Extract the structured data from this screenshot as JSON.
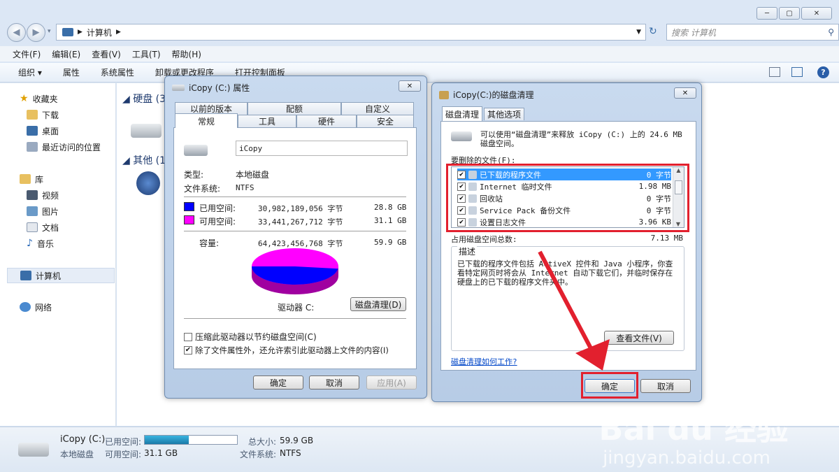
{
  "explorer": {
    "address": "计算机",
    "search_placeholder": "搜索 计算机",
    "menu": [
      "文件(F)",
      "编辑(E)",
      "查看(V)",
      "工具(T)",
      "帮助(H)"
    ],
    "commands": [
      "组织 ▾",
      "属性",
      "系统属性",
      "卸载或更改程序",
      "打开控制面板"
    ],
    "sidebar": {
      "favorites": "收藏夹",
      "fav_items": [
        "下载",
        "桌面",
        "最近访问的位置"
      ],
      "library": "库",
      "lib_items": [
        "视频",
        "图片",
        "文档",
        "音乐"
      ],
      "computer": "计算机",
      "network": "网络"
    },
    "groups": {
      "disk": "硬盘 (3",
      "other": "其他 (1"
    }
  },
  "status": {
    "drive_name": "iCopy (C:)",
    "drive_type": "本地磁盘",
    "used_label": "已用空间:",
    "free_label": "可用空间:",
    "free_value": "31.1 GB",
    "total_label": "总大小:",
    "total_value": "59.9 GB",
    "fs_label": "文件系统:",
    "fs_value": "NTFS",
    "used_fraction": 0.48
  },
  "props": {
    "title": "iCopy (C:) 属性",
    "tabs_back": [
      "以前的版本",
      "配额",
      "自定义"
    ],
    "tabs_front": [
      "常规",
      "工具",
      "硬件",
      "安全"
    ],
    "name_value": "iCopy",
    "type_label": "类型:",
    "type_value": "本地磁盘",
    "fs_label": "文件系统:",
    "fs_value": "NTFS",
    "used_label": "已用空间:",
    "used_bytes": "30,982,189,056 字节",
    "used_gb": "28.8 GB",
    "free_label": "可用空间:",
    "free_bytes": "33,441,267,712 字节",
    "free_gb": "31.1 GB",
    "cap_label": "容量:",
    "cap_bytes": "64,423,456,768 字节",
    "cap_gb": "59.9 GB",
    "drive_label": "驱动器 C:",
    "cleanup_btn": "磁盘清理(D)",
    "compress_label": "压缩此驱动器以节约磁盘空间(C)",
    "index_label": "除了文件属性外，还允许索引此驱动器上文件的内容(I)",
    "ok": "确定",
    "cancel": "取消",
    "apply": "应用(A)",
    "colors": {
      "used": "#0000ff",
      "free": "#ff00ff"
    }
  },
  "cleanup": {
    "title": "iCopy(C:)的磁盘清理",
    "tab_active": "磁盘清理",
    "tab_other": "其他选项",
    "intro": "可以使用“磁盘清理”来释放 iCopy (C:) 上的 24.6 MB 磁盘空间。",
    "files_label": "要删除的文件(F):",
    "files": [
      {
        "name": "已下载的程序文件",
        "size": "0 字节",
        "checked": true,
        "selected": true
      },
      {
        "name": "Internet 临时文件",
        "size": "1.98 MB",
        "checked": true,
        "selected": false
      },
      {
        "name": "回收站",
        "size": "0 字节",
        "checked": true,
        "selected": false
      },
      {
        "name": "Service Pack 备份文件",
        "size": "0 字节",
        "checked": true,
        "selected": false
      },
      {
        "name": "设置日志文件",
        "size": "3.96 KB",
        "checked": true,
        "selected": false
      }
    ],
    "total_label": "占用磁盘空间总数:",
    "total_value": "7.13 MB",
    "desc_title": "描述",
    "desc_text": "已下载的程序文件包括 ActiveX 控件和 Java 小程序，你查看特定网页时将会从 Internet 自动下载它们，并临时保存在硬盘上的已下载的程序文件夹中。",
    "view_files": "查看文件(V)",
    "howto": "磁盘清理如何工作?",
    "ok": "确定",
    "cancel": "取消"
  },
  "watermark": {
    "brand": "Bai du 经验",
    "url": "jingyan.baidu.com"
  }
}
